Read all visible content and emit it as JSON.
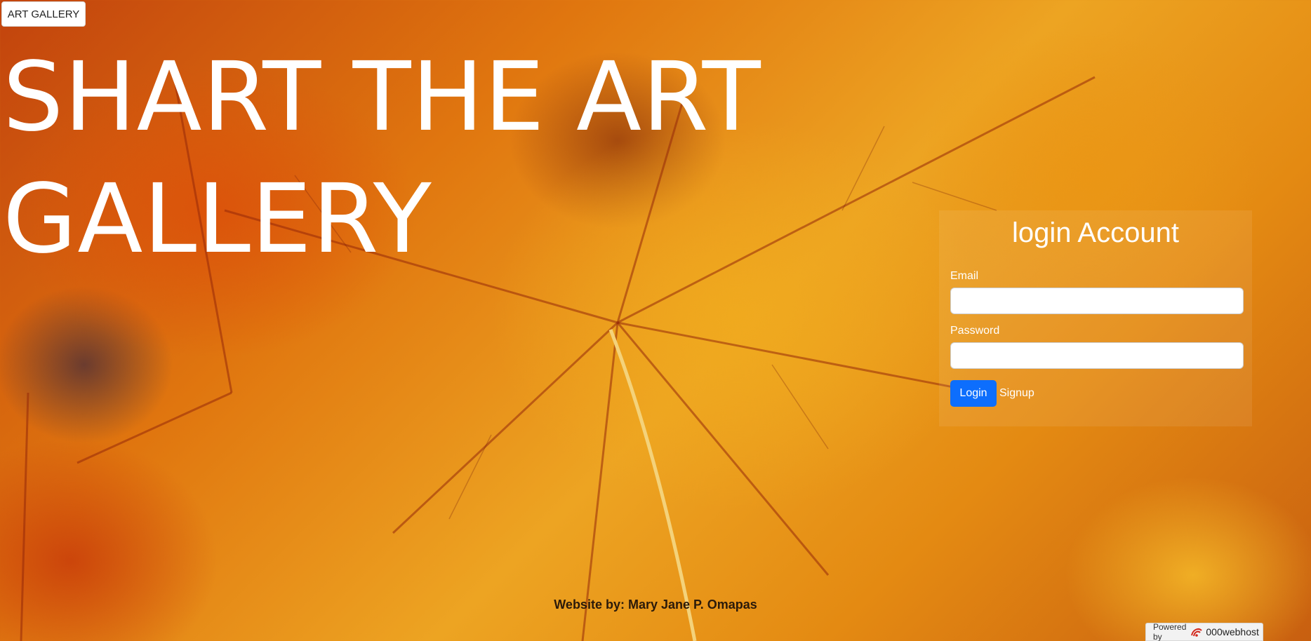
{
  "nav": {
    "brand_label": "ART GALLERY"
  },
  "hero": {
    "title": "SHART THE ART GALLERY"
  },
  "login": {
    "title": "login Account",
    "email_label": "Email",
    "email_value": "",
    "password_label": "Password",
    "password_value": "",
    "login_button": "Login",
    "signup_link": "Signup"
  },
  "footer": {
    "credit": "Website by: Mary Jane P. Omapas"
  },
  "badge": {
    "powered_by": "Powered by",
    "host_icon": "000webhost-logo-icon",
    "host_name": "000webhost"
  },
  "colors": {
    "login_button": "#0d6efd",
    "text_light": "#ffffff",
    "footer_text": "#2b1a0a"
  }
}
